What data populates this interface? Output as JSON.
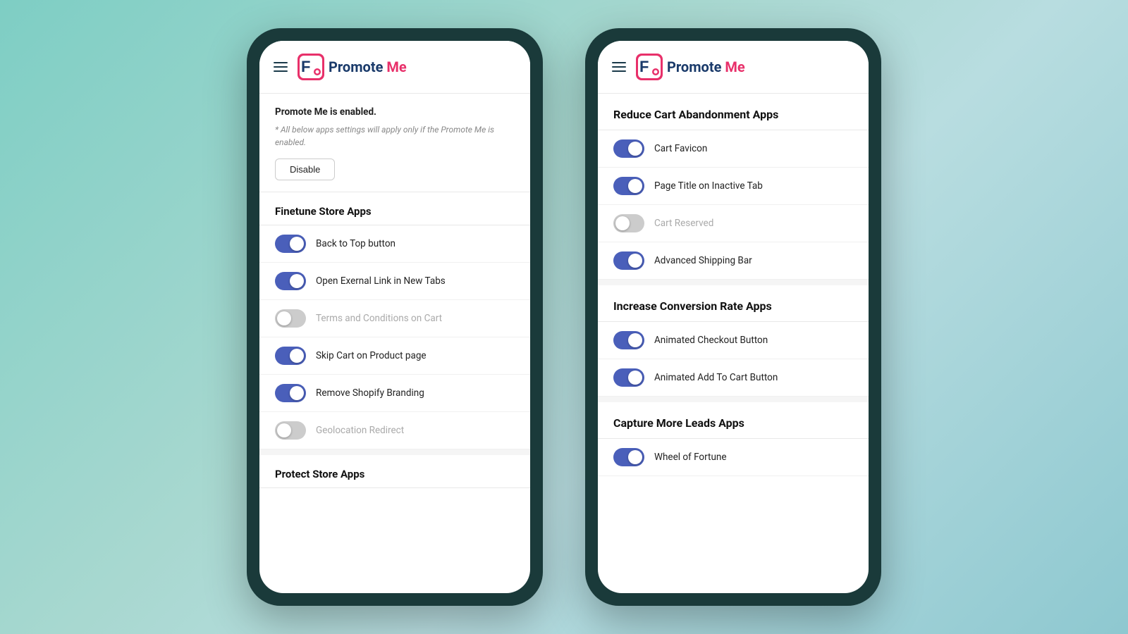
{
  "left_phone": {
    "header": {
      "logo_promote": "Promote",
      "logo_me": " Me"
    },
    "status": {
      "enabled_text": "Promote Me is enabled.",
      "note": "* All below apps settings will apply only if the Promote Me is enabled.",
      "disable_button": "Disable"
    },
    "finetune_section": {
      "title": "Finetune Store Apps",
      "items": [
        {
          "label": "Back to Top button",
          "state": "on"
        },
        {
          "label": "Open Exernal Link in New Tabs",
          "state": "on"
        },
        {
          "label": "Terms and Conditions on Cart",
          "state": "off"
        },
        {
          "label": "Skip Cart on Product page",
          "state": "on"
        },
        {
          "label": "Remove Shopify Branding",
          "state": "on"
        },
        {
          "label": "Geolocation Redirect",
          "state": "off"
        }
      ]
    },
    "protect_section": {
      "title": "Protect Store Apps"
    }
  },
  "right_phone": {
    "header": {
      "logo_promote": "Promote",
      "logo_me": " Me"
    },
    "reduce_section": {
      "title": "Reduce Cart Abandonment Apps",
      "items": [
        {
          "label": "Cart Favicon",
          "state": "on"
        },
        {
          "label": "Page Title on Inactive Tab",
          "state": "on"
        },
        {
          "label": "Cart Reserved",
          "state": "off"
        },
        {
          "label": "Advanced Shipping Bar",
          "state": "on"
        }
      ]
    },
    "conversion_section": {
      "title": "Increase Conversion Rate Apps",
      "items": [
        {
          "label": "Animated Checkout Button",
          "state": "on"
        },
        {
          "label": "Animated Add To Cart Button",
          "state": "on"
        }
      ]
    },
    "leads_section": {
      "title": "Capture More Leads Apps",
      "items": [
        {
          "label": "Wheel of Fortune",
          "state": "on"
        }
      ]
    }
  }
}
